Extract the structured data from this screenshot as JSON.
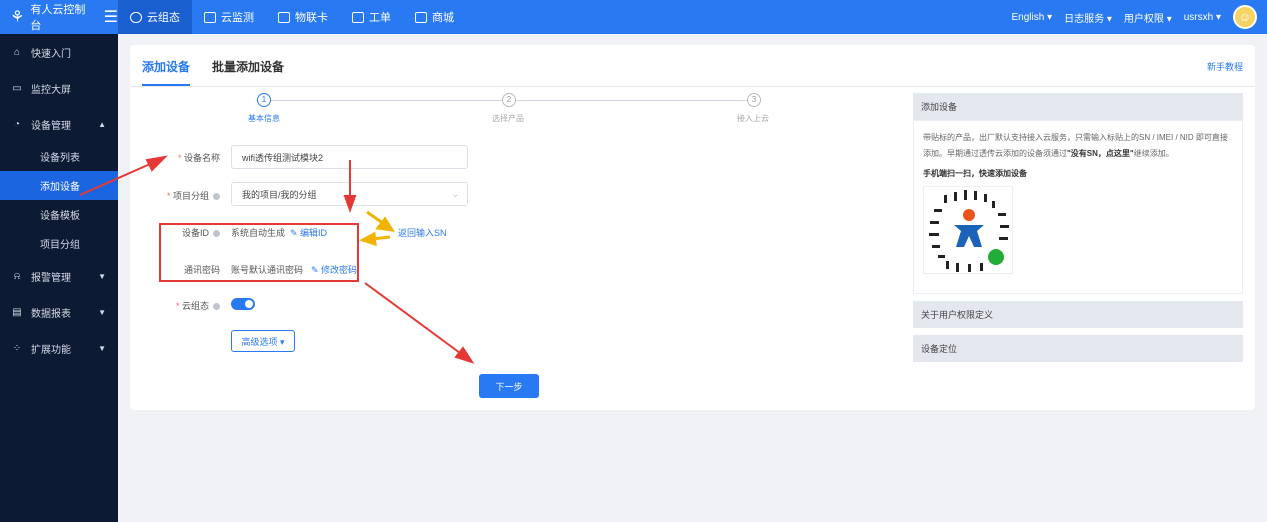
{
  "topbar": {
    "brand": "有人云控制台",
    "nav": [
      "云组态",
      "云监测",
      "物联卡",
      "工单",
      "商城"
    ],
    "right": [
      "English ▾",
      "日志服务 ▾",
      "用户权限 ▾",
      "usrsxh ▾"
    ]
  },
  "sidebar": {
    "items": [
      {
        "label": "快速入门",
        "icon": "home-icon"
      },
      {
        "label": "监控大屏",
        "icon": "monitor-icon"
      },
      {
        "label": "设备管理",
        "icon": "device-icon"
      },
      {
        "label": "设备列表"
      },
      {
        "label": "添加设备"
      },
      {
        "label": "设备模板"
      },
      {
        "label": "项目分组"
      },
      {
        "label": "报警管理",
        "icon": "alarm-icon"
      },
      {
        "label": "数据报表",
        "icon": "report-icon"
      },
      {
        "label": "扩展功能",
        "icon": "extend-icon"
      }
    ]
  },
  "main": {
    "tabs": [
      "添加设备",
      "批量添加设备"
    ],
    "help_link": "新手教程",
    "steps": [
      "基本信息",
      "选择产品",
      "接入上云"
    ],
    "step_numbers": [
      "1",
      "2",
      "3"
    ],
    "form": {
      "device_name_label": "设备名称",
      "device_name_value": "wifi透传组测试模块2",
      "project_group_label": "项目分组",
      "project_group_value": "我的项目/我的分组",
      "device_id_label": "设备ID",
      "device_id_value": "系统自动生成",
      "edit_id": "编辑ID",
      "return_sn": "返回输入SN",
      "comm_password_label": "通讯密码",
      "comm_password_value": "账号默认通讯密码",
      "edit_password": "修改密码",
      "cloud_config_label": "云组态",
      "advanced": "高级选项 ▾",
      "next": "下一步"
    },
    "panel": {
      "title": "添加设备",
      "desc_1": "带贴标的产品，出厂默认支持接入云服务，只需输入标贴上的SN / IMEI / NID 即可直接添加。早期通过透传云添加的设备须通过",
      "desc_bold": "\"没有SN，点这里\"",
      "desc_2": "继续添加。",
      "scan": "手机端扫一扫，快速添加设备",
      "section_2": "关于用户权限定义",
      "section_3": "设备定位"
    }
  }
}
